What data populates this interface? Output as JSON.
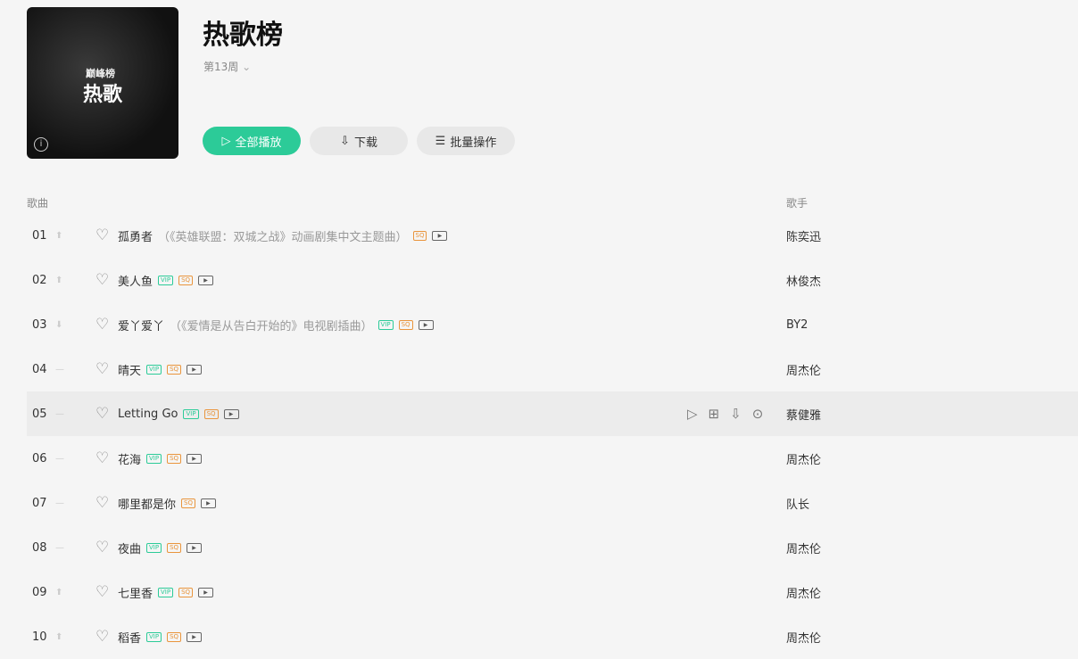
{
  "header": {
    "title": "热歌榜",
    "week": "第13周",
    "cover_logo": "巅峰榜",
    "cover_text": "热歌"
  },
  "buttons": {
    "play_all": "全部播放",
    "download": "下载",
    "batch": "批量操作"
  },
  "columns": {
    "song": "歌曲",
    "artist": "歌手"
  },
  "songs": [
    {
      "rank": "01",
      "trend": "up",
      "name": "孤勇者",
      "sub": "（《英雄联盟：双城之战》动画剧集中文主题曲）",
      "vip": false,
      "sq": true,
      "artist": "陈奕迅"
    },
    {
      "rank": "02",
      "trend": "up",
      "name": "美人鱼",
      "sub": "",
      "vip": true,
      "sq": true,
      "artist": "林俊杰"
    },
    {
      "rank": "03",
      "trend": "down",
      "name": "爱丫爱丫",
      "sub": "（《爱情是从告白开始的》电视剧插曲）",
      "vip": true,
      "sq": true,
      "artist": "BY2"
    },
    {
      "rank": "04",
      "trend": "flat",
      "name": "晴天",
      "sub": "",
      "vip": true,
      "sq": true,
      "artist": "周杰伦"
    },
    {
      "rank": "05",
      "trend": "flat",
      "name": "Letting Go",
      "sub": "",
      "vip": true,
      "sq": true,
      "artist": "蔡健雅"
    },
    {
      "rank": "06",
      "trend": "flat",
      "name": "花海",
      "sub": "",
      "vip": true,
      "sq": true,
      "artist": "周杰伦"
    },
    {
      "rank": "07",
      "trend": "flat",
      "name": "哪里都是你",
      "sub": "",
      "vip": false,
      "sq": true,
      "artist": "队长"
    },
    {
      "rank": "08",
      "trend": "flat",
      "name": "夜曲",
      "sub": "",
      "vip": true,
      "sq": true,
      "artist": "周杰伦"
    },
    {
      "rank": "09",
      "trend": "up",
      "name": "七里香",
      "sub": "",
      "vip": true,
      "sq": true,
      "artist": "周杰伦"
    },
    {
      "rank": "10",
      "trend": "up",
      "name": "稻香",
      "sub": "",
      "vip": true,
      "sq": true,
      "artist": "周杰伦"
    }
  ],
  "tags": {
    "vip": "VIP",
    "sq": "SQ"
  },
  "hover_row": 4
}
